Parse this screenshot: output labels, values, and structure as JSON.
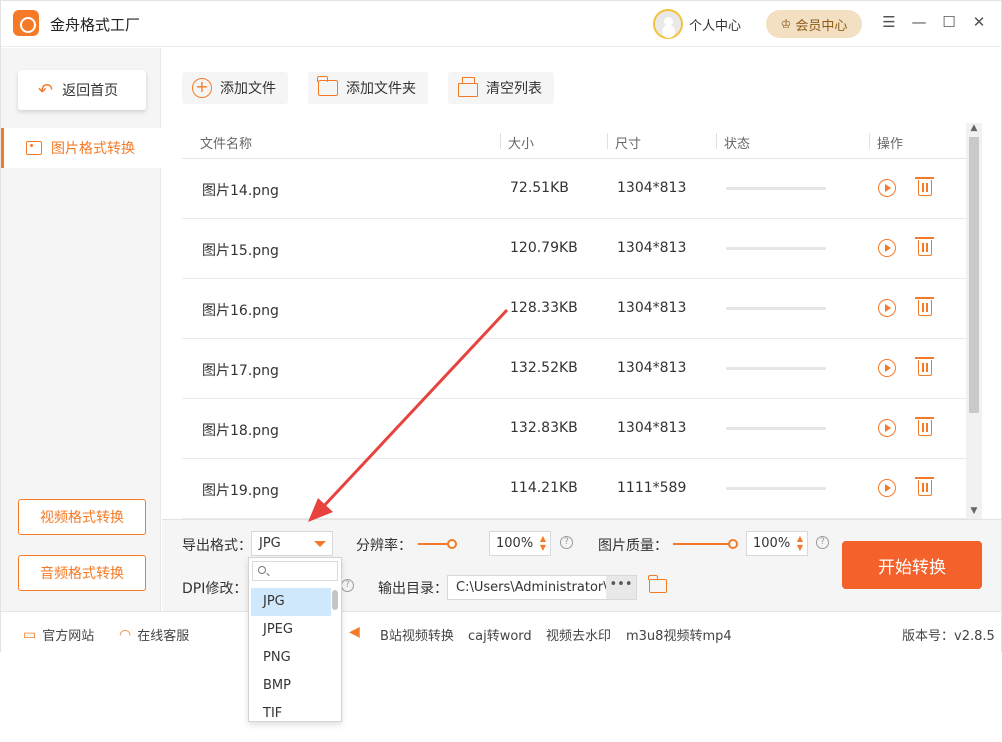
{
  "app": {
    "title": "金舟格式工厂"
  },
  "header": {
    "profile_label": "个人中心",
    "vip_label": "会员中心"
  },
  "sidebar": {
    "back_label": "返回首页",
    "active_label": "图片格式转换",
    "video_label": "视频格式转换",
    "audio_label": "音频格式转换"
  },
  "toolbar": {
    "add_file": "添加文件",
    "add_folder": "添加文件夹",
    "clear_list": "清空列表"
  },
  "table": {
    "headers": {
      "name": "文件名称",
      "size": "大小",
      "dims": "尺寸",
      "status": "状态",
      "actions": "操作"
    },
    "rows": [
      {
        "name": "图片14.png",
        "size": "72.51KB",
        "dims": "1304*813"
      },
      {
        "name": "图片15.png",
        "size": "120.79KB",
        "dims": "1304*813"
      },
      {
        "name": "图片16.png",
        "size": "128.33KB",
        "dims": "1304*813"
      },
      {
        "name": "图片17.png",
        "size": "132.52KB",
        "dims": "1304*813"
      },
      {
        "name": "图片18.png",
        "size": "132.83KB",
        "dims": "1304*813"
      },
      {
        "name": "图片19.png",
        "size": "114.21KB",
        "dims": "1111*589"
      }
    ]
  },
  "settings": {
    "format_label": "导出格式：",
    "format_value": "JPG",
    "resolution_label": "分辨率：",
    "resolution_value": "100",
    "percent": "%",
    "quality_label": "图片质量：",
    "quality_value": "100",
    "dpi_label": "DPI修改：",
    "output_label": "输出目录：",
    "output_path": "C:\\Users\\Administrator\\De",
    "more": "•••",
    "help": "?",
    "start_label": "开始转换"
  },
  "dropdown": {
    "options": [
      "JPG",
      "JPEG",
      "PNG",
      "BMP",
      "TIF"
    ],
    "selected": "JPG"
  },
  "footer": {
    "website": "官方网站",
    "service": "在线客服",
    "link1": "B站视频转换",
    "link2": "caj转word",
    "link3": "视频去水印",
    "link4": "m3u8视频转mp4",
    "version": "版本号：v2.8.5"
  },
  "colors": {
    "accent": "#f47a27",
    "start_button": "#f4612a",
    "annotation_arrow": "#e8423f"
  }
}
